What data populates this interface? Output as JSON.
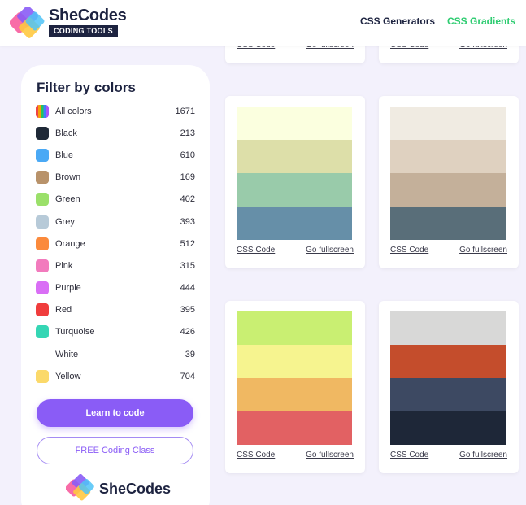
{
  "header": {
    "brand_name": "SheCodes",
    "brand_tag": "CODING TOOLS",
    "nav": [
      {
        "label": "CSS Generators"
      },
      {
        "label": "CSS Gradients"
      }
    ]
  },
  "sidebar": {
    "title": "Filter by colors",
    "colors": [
      {
        "label": "All colors",
        "count": "1671",
        "color": "rainbow"
      },
      {
        "label": "Black",
        "count": "213",
        "color": "#1f2937"
      },
      {
        "label": "Blue",
        "count": "610",
        "color": "#4aa9f5"
      },
      {
        "label": "Brown",
        "count": "169",
        "color": "#b8926a"
      },
      {
        "label": "Green",
        "count": "402",
        "color": "#9be06a"
      },
      {
        "label": "Grey",
        "count": "393",
        "color": "#b7cad8"
      },
      {
        "label": "Orange",
        "count": "512",
        "color": "#fb8a3c"
      },
      {
        "label": "Pink",
        "count": "315",
        "color": "#f27bbd"
      },
      {
        "label": "Purple",
        "count": "444",
        "color": "#d96ef5"
      },
      {
        "label": "Red",
        "count": "395",
        "color": "#f03d3d"
      },
      {
        "label": "Turquoise",
        "count": "426",
        "color": "#35d6b4"
      },
      {
        "label": "White",
        "count": "39",
        "color": "#ffffff"
      },
      {
        "label": "Yellow",
        "count": "704",
        "color": "#fbd96a"
      }
    ],
    "learn_button": "Learn to code",
    "free_button": "FREE Coding Class",
    "footer_brand": "SheCodes"
  },
  "cards": [
    {
      "code_link": "CSS Code",
      "fullscreen_link": "Go fullscreen",
      "bands": []
    },
    {
      "code_link": "CSS Code",
      "fullscreen_link": "Go fullscreen",
      "bands": []
    },
    {
      "code_link": "CSS Code",
      "fullscreen_link": "Go fullscreen",
      "bands": [
        "#fbffdf",
        "#dddfa9",
        "#99cbaa",
        "#668fa8"
      ]
    },
    {
      "code_link": "CSS Code",
      "fullscreen_link": "Go fullscreen",
      "bands": [
        "#f0ebe2",
        "#dfd1c0",
        "#c4b09a",
        "#596e79"
      ]
    },
    {
      "code_link": "CSS Code",
      "fullscreen_link": "Go fullscreen",
      "bands": [
        "#c9ef72",
        "#f6f48f",
        "#f0b862",
        "#e26163"
      ]
    },
    {
      "code_link": "CSS Code",
      "fullscreen_link": "Go fullscreen",
      "bands": [
        "#d8d8d7",
        "#c44d2c",
        "#3d4962",
        "#1e2738"
      ]
    }
  ]
}
